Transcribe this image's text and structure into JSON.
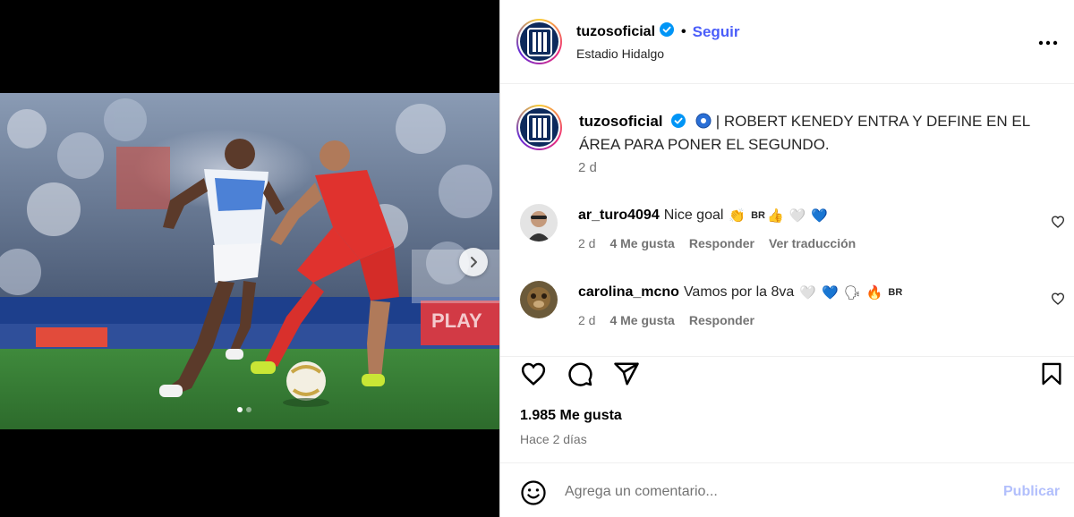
{
  "header": {
    "username": "tuzosoficial",
    "separator": "•",
    "follow_label": "Seguir",
    "location": "Estadio Hidalgo"
  },
  "caption": {
    "username": "tuzosoficial",
    "text": " | ROBERT KENEDY ENTRA Y DEFINE EN EL ÁREA PARA PONER EL SEGUNDO.",
    "time": "2 d"
  },
  "comments": [
    {
      "username": "ar_turo4094",
      "text": "Nice goal",
      "emojis": [
        "👏",
        "BR",
        "👍",
        "🤍",
        "💙"
      ],
      "time": "2 d",
      "likes": "4 Me gusta",
      "reply": "Responder",
      "translate": "Ver traducción"
    },
    {
      "username": "carolina_mcno",
      "text": "Vamos por la 8va",
      "emojis": [
        "🤍",
        "💙",
        "🗣",
        "🔥",
        "BR"
      ],
      "time": "2 d",
      "likes": "4 Me gusta",
      "reply": "Responder"
    }
  ],
  "post": {
    "likes": "1.985 Me gusta",
    "ago": "Hace 2 días"
  },
  "add_comment": {
    "placeholder": "Agrega un comentario...",
    "publish_label": "Publicar"
  },
  "carousel": {
    "total": 2,
    "current": 1
  },
  "colors": {
    "link": "#4a5df9",
    "muted": "#737373",
    "publish_disabled": "#b2bffc",
    "verified": "#0095f6"
  },
  "icons": {
    "verified": "verified-badge-icon",
    "more": "more-options-icon",
    "like": "heart-icon",
    "comment": "comment-icon",
    "share": "share-icon",
    "save": "bookmark-icon",
    "emoji": "emoji-icon",
    "next": "chevron-right-icon"
  }
}
